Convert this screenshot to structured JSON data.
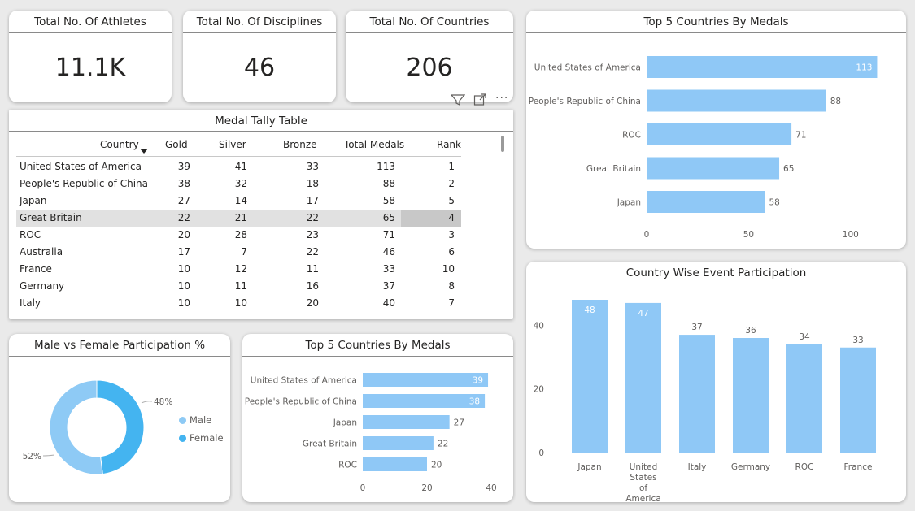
{
  "colors": {
    "bar": "#8fc8f6",
    "male": "#8ecaf5",
    "female": "#44b4f0",
    "row_highlight": "#e1e1e1",
    "rank_highlight": "#c8c8c8"
  },
  "kpis": [
    {
      "label": "Total No. Of Athletes",
      "value": "11.1K"
    },
    {
      "label": "Total No. Of Disciplines",
      "value": "46"
    },
    {
      "label": "Total No. Of Countries",
      "value": "206"
    }
  ],
  "medal_table": {
    "title": "Medal Tally Table",
    "columns": [
      "Country",
      "Gold",
      "Silver",
      "Bronze",
      "Total Medals",
      "Rank"
    ],
    "sort_column": "Country",
    "rows": [
      [
        "United States of America",
        "39",
        "41",
        "33",
        "113",
        "1"
      ],
      [
        "People's Republic of China",
        "38",
        "32",
        "18",
        "88",
        "2"
      ],
      [
        "Japan",
        "27",
        "14",
        "17",
        "58",
        "5"
      ],
      [
        "Great Britain",
        "22",
        "21",
        "22",
        "65",
        "4"
      ],
      [
        "ROC",
        "20",
        "28",
        "23",
        "71",
        "3"
      ],
      [
        "Australia",
        "17",
        "7",
        "22",
        "46",
        "6"
      ],
      [
        "France",
        "10",
        "12",
        "11",
        "33",
        "10"
      ],
      [
        "Germany",
        "10",
        "11",
        "16",
        "37",
        "8"
      ],
      [
        "Italy",
        "10",
        "10",
        "20",
        "40",
        "7"
      ]
    ],
    "highlighted_row": 3,
    "toolbar_icons": [
      "filter-icon",
      "focus-mode-icon",
      "more-options-icon"
    ]
  },
  "chart_data": [
    {
      "type": "bar",
      "orientation": "horizontal",
      "title": "Top 5 Countries By Medals",
      "categories": [
        "United States of America",
        "People's Republic of China",
        "ROC",
        "Great Britain",
        "Japan"
      ],
      "values": [
        113,
        88,
        71,
        65,
        58
      ],
      "xlim": [
        0,
        120
      ],
      "ticks": [
        0,
        50,
        100
      ],
      "grid": false
    },
    {
      "type": "bar",
      "orientation": "vertical",
      "title": "Country Wise Event Participation",
      "categories": [
        "Japan",
        "United States of America",
        "Italy",
        "Germany",
        "ROC",
        "France"
      ],
      "values": [
        48,
        47,
        37,
        36,
        34,
        33
      ],
      "ylim": [
        0,
        48
      ],
      "ticks": [
        0,
        20,
        40
      ],
      "grid": false
    },
    {
      "type": "pie",
      "donut": true,
      "title": "Male vs Female Participation %",
      "labels": [
        "Male",
        "Female"
      ],
      "values": [
        52,
        48
      ],
      "value_labels": [
        "52%",
        "48%"
      ],
      "legend": "right"
    },
    {
      "type": "bar",
      "orientation": "horizontal",
      "title": "Top 5 Countries By Medals",
      "categories": [
        "United States of America",
        "People's Republic of China",
        "Japan",
        "Great Britain",
        "ROC"
      ],
      "values": [
        39,
        38,
        27,
        22,
        20
      ],
      "xlim": [
        0,
        40
      ],
      "ticks": [
        0,
        20,
        40
      ],
      "grid": false
    }
  ]
}
